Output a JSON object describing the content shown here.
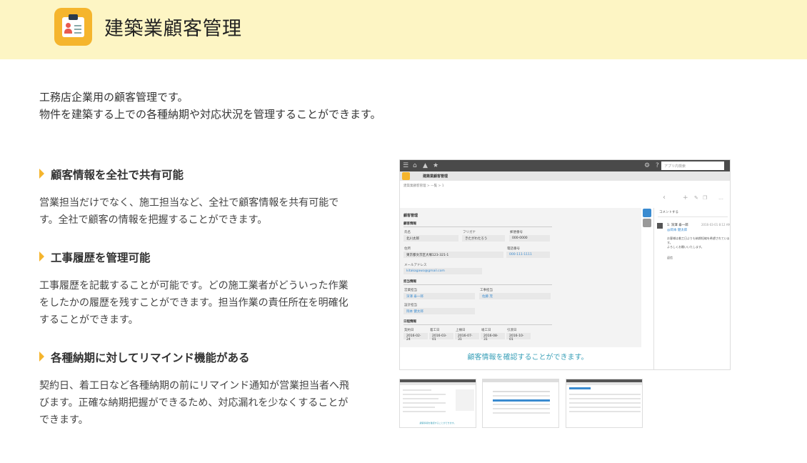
{
  "header": {
    "app_icon": "customer-card-icon",
    "title": "建築業顧客管理"
  },
  "intro": {
    "line1": "工務店企業用の顧客管理です。",
    "line2": "物件を建築する上での各種納期や対応状況を管理することができます。"
  },
  "features": [
    {
      "title": "顧客情報を全社で共有可能",
      "desc_line1": "営業担当だけでなく、施工担当など、全社で顧客情報を共有可能で",
      "desc_line2": "す。全社で顧客の情報を把握することができます。"
    },
    {
      "title": "工事履歴を管理可能",
      "desc_line1": "工事履歴を記載することが可能です。どの施工業者がどういった作業",
      "desc_line2": "をしたかの履歴を残すことができます。担当作業の責任所在を明確化",
      "desc_line3": "することができます。"
    },
    {
      "title": "各種納期に対してリマインド機能がある",
      "desc_line1": "契約日、着工日など各種納期の前にリマインド通知が営業担当者へ飛",
      "desc_line2": "びます。正確な納期把握ができるため、対応漏れを少なくすることが",
      "desc_line3": "できます。"
    }
  ],
  "screenshot": {
    "search_placeholder": "アプリ内検索",
    "app_name": "建築業顧客管理",
    "breadcrumb": "建築業顧客管理 > 一覧 > 1",
    "record_title": "顧客管理",
    "section_customer": "顧客情報",
    "label_name": "氏名",
    "value_name": "北川太郎",
    "label_kana": "フリガナ",
    "value_kana": "きたがわたろう",
    "label_zip": "郵便番号",
    "value_zip": "000-0000",
    "label_address": "住所",
    "value_address": "東京都文京区大塚123-321-1",
    "label_phone": "電話番号",
    "value_phone": "000-111-1111",
    "label_email": "メールアドレス",
    "value_email": "kitakagawa@gmail.com",
    "section_staff": "担当情報",
    "label_sales": "営業担当",
    "value_sales": "深澤 泰一郎",
    "label_construction": "工事担当",
    "value_construction": "佐藤 茂",
    "label_design": "設計担当",
    "value_design": "岡本 健太郎",
    "section_dates": "日程情報",
    "date_labels": [
      "契約日",
      "着工日",
      "上棟日",
      "竣工日",
      "引渡日"
    ],
    "date_values": [
      "2016-02-24",
      "2016-03-01",
      "2016-07-31",
      "2016-08-31",
      "2016-10-01"
    ],
    "comment_header": "コメントする",
    "comment_author": "1: 深澤 泰一郎",
    "comment_time": "2016-03-01 8:12 AM",
    "comment_mention": "@岡本 健太郎",
    "comment_body1": "お客様は着工日よりも納期短縮を希望されていま",
    "comment_body2": "す。",
    "comment_body3": "よろしくお願いいたします。",
    "comment_reply": "返信",
    "caption": "顧客情報を確認することができます。"
  }
}
